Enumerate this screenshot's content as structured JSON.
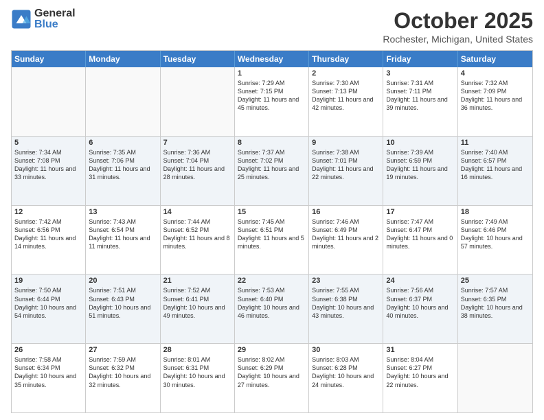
{
  "logo": {
    "general": "General",
    "blue": "Blue"
  },
  "header": {
    "month": "October 2025",
    "location": "Rochester, Michigan, United States"
  },
  "weekdays": [
    "Sunday",
    "Monday",
    "Tuesday",
    "Wednesday",
    "Thursday",
    "Friday",
    "Saturday"
  ],
  "rows": [
    [
      {
        "day": "",
        "info": ""
      },
      {
        "day": "",
        "info": ""
      },
      {
        "day": "",
        "info": ""
      },
      {
        "day": "1",
        "info": "Sunrise: 7:29 AM\nSunset: 7:15 PM\nDaylight: 11 hours and 45 minutes."
      },
      {
        "day": "2",
        "info": "Sunrise: 7:30 AM\nSunset: 7:13 PM\nDaylight: 11 hours and 42 minutes."
      },
      {
        "day": "3",
        "info": "Sunrise: 7:31 AM\nSunset: 7:11 PM\nDaylight: 11 hours and 39 minutes."
      },
      {
        "day": "4",
        "info": "Sunrise: 7:32 AM\nSunset: 7:09 PM\nDaylight: 11 hours and 36 minutes."
      }
    ],
    [
      {
        "day": "5",
        "info": "Sunrise: 7:34 AM\nSunset: 7:08 PM\nDaylight: 11 hours and 33 minutes."
      },
      {
        "day": "6",
        "info": "Sunrise: 7:35 AM\nSunset: 7:06 PM\nDaylight: 11 hours and 31 minutes."
      },
      {
        "day": "7",
        "info": "Sunrise: 7:36 AM\nSunset: 7:04 PM\nDaylight: 11 hours and 28 minutes."
      },
      {
        "day": "8",
        "info": "Sunrise: 7:37 AM\nSunset: 7:02 PM\nDaylight: 11 hours and 25 minutes."
      },
      {
        "day": "9",
        "info": "Sunrise: 7:38 AM\nSunset: 7:01 PM\nDaylight: 11 hours and 22 minutes."
      },
      {
        "day": "10",
        "info": "Sunrise: 7:39 AM\nSunset: 6:59 PM\nDaylight: 11 hours and 19 minutes."
      },
      {
        "day": "11",
        "info": "Sunrise: 7:40 AM\nSunset: 6:57 PM\nDaylight: 11 hours and 16 minutes."
      }
    ],
    [
      {
        "day": "12",
        "info": "Sunrise: 7:42 AM\nSunset: 6:56 PM\nDaylight: 11 hours and 14 minutes."
      },
      {
        "day": "13",
        "info": "Sunrise: 7:43 AM\nSunset: 6:54 PM\nDaylight: 11 hours and 11 minutes."
      },
      {
        "day": "14",
        "info": "Sunrise: 7:44 AM\nSunset: 6:52 PM\nDaylight: 11 hours and 8 minutes."
      },
      {
        "day": "15",
        "info": "Sunrise: 7:45 AM\nSunset: 6:51 PM\nDaylight: 11 hours and 5 minutes."
      },
      {
        "day": "16",
        "info": "Sunrise: 7:46 AM\nSunset: 6:49 PM\nDaylight: 11 hours and 2 minutes."
      },
      {
        "day": "17",
        "info": "Sunrise: 7:47 AM\nSunset: 6:47 PM\nDaylight: 11 hours and 0 minutes."
      },
      {
        "day": "18",
        "info": "Sunrise: 7:49 AM\nSunset: 6:46 PM\nDaylight: 10 hours and 57 minutes."
      }
    ],
    [
      {
        "day": "19",
        "info": "Sunrise: 7:50 AM\nSunset: 6:44 PM\nDaylight: 10 hours and 54 minutes."
      },
      {
        "day": "20",
        "info": "Sunrise: 7:51 AM\nSunset: 6:43 PM\nDaylight: 10 hours and 51 minutes."
      },
      {
        "day": "21",
        "info": "Sunrise: 7:52 AM\nSunset: 6:41 PM\nDaylight: 10 hours and 49 minutes."
      },
      {
        "day": "22",
        "info": "Sunrise: 7:53 AM\nSunset: 6:40 PM\nDaylight: 10 hours and 46 minutes."
      },
      {
        "day": "23",
        "info": "Sunrise: 7:55 AM\nSunset: 6:38 PM\nDaylight: 10 hours and 43 minutes."
      },
      {
        "day": "24",
        "info": "Sunrise: 7:56 AM\nSunset: 6:37 PM\nDaylight: 10 hours and 40 minutes."
      },
      {
        "day": "25",
        "info": "Sunrise: 7:57 AM\nSunset: 6:35 PM\nDaylight: 10 hours and 38 minutes."
      }
    ],
    [
      {
        "day": "26",
        "info": "Sunrise: 7:58 AM\nSunset: 6:34 PM\nDaylight: 10 hours and 35 minutes."
      },
      {
        "day": "27",
        "info": "Sunrise: 7:59 AM\nSunset: 6:32 PM\nDaylight: 10 hours and 32 minutes."
      },
      {
        "day": "28",
        "info": "Sunrise: 8:01 AM\nSunset: 6:31 PM\nDaylight: 10 hours and 30 minutes."
      },
      {
        "day": "29",
        "info": "Sunrise: 8:02 AM\nSunset: 6:29 PM\nDaylight: 10 hours and 27 minutes."
      },
      {
        "day": "30",
        "info": "Sunrise: 8:03 AM\nSunset: 6:28 PM\nDaylight: 10 hours and 24 minutes."
      },
      {
        "day": "31",
        "info": "Sunrise: 8:04 AM\nSunset: 6:27 PM\nDaylight: 10 hours and 22 minutes."
      },
      {
        "day": "",
        "info": ""
      }
    ]
  ]
}
